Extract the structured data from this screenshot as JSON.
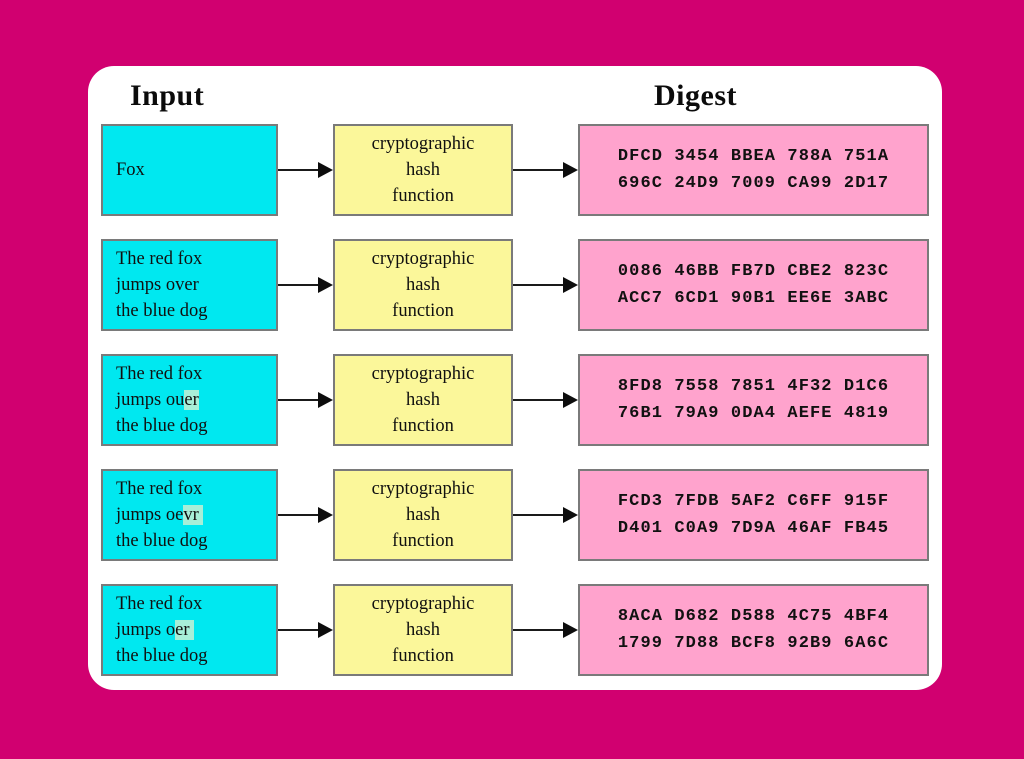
{
  "diagram": {
    "headers": {
      "input": "Input",
      "digest": "Digest"
    },
    "hash_function": {
      "line1": "cryptographic",
      "line2": "hash",
      "line3": "function"
    },
    "colors": {
      "background": "#d10070",
      "card": "#ffffff",
      "input_box": "#00e8f0",
      "input_highlight": "#a8efd8",
      "hash_box": "#fbf79a",
      "digest_box": "#ffa3cd",
      "box_border": "#7a7a7a",
      "arrow": "#0d0d0d",
      "text": "#101010"
    },
    "rows": [
      {
        "input_prefix": "Fox",
        "input_highlight": "",
        "input_suffix": "",
        "digest_line1": "DFCD 3454 BBEA 788A 751A",
        "digest_line2": "696C 24D9 7009 CA99 2D17"
      },
      {
        "input_prefix": "The red fox\njumps over\nthe blue dog",
        "input_highlight": "",
        "input_suffix": "",
        "digest_line1": "0086 46BB FB7D CBE2 823C",
        "digest_line2": "ACC7 6CD1 90B1 EE6E 3ABC"
      },
      {
        "input_prefix": "The red fox\njumps ou",
        "input_highlight": "er",
        "input_suffix": "\nthe blue dog",
        "digest_line1": "8FD8 7558 7851 4F32 D1C6",
        "digest_line2": "76B1 79A9 0DA4 AEFE 4819"
      },
      {
        "input_prefix": "The red fox\njumps oe",
        "input_highlight": "vr ",
        "input_suffix": "\nthe blue dog",
        "digest_line1": "FCD3 7FDB 5AF2 C6FF 915F",
        "digest_line2": "D401 C0A9 7D9A 46AF FB45"
      },
      {
        "input_prefix": "The red fox\njumps o",
        "input_highlight": "er ",
        "input_suffix": "\nthe blue dog",
        "digest_line1": "8ACA D682 D588 4C75 4BF4",
        "digest_line2": "1799 7D88 BCF8 92B9 6A6C"
      }
    ]
  }
}
